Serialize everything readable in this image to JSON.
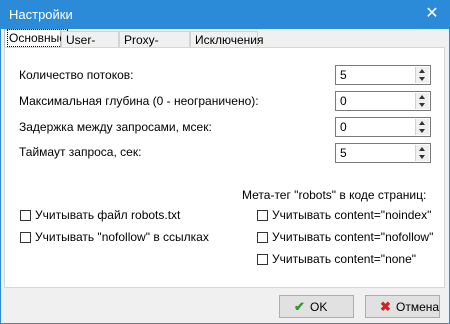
{
  "window": {
    "title": "Настройки",
    "close_glyph": "✕"
  },
  "tabs": [
    {
      "label": "Основные",
      "active": true
    },
    {
      "label": "User-Agent",
      "active": false
    },
    {
      "label": "Proxy-сервер",
      "active": false
    },
    {
      "label": "Исключения",
      "active": false
    }
  ],
  "fields": [
    {
      "label": "Количество потоков:",
      "value": "5"
    },
    {
      "label": "Максимальная глубина (0 - неограничено):",
      "value": "0"
    },
    {
      "label": "Задержка между запросами, мсек:",
      "value": "0"
    },
    {
      "label": "Таймаут запроса, сек:",
      "value": "5"
    }
  ],
  "left_checks": [
    {
      "label": "Учитывать файл robots.txt",
      "checked": false
    },
    {
      "label": "Учитывать \"nofollow\" в ссылках",
      "checked": false
    }
  ],
  "meta": {
    "title": "Мета-тег \"robots\" в коде страниц:",
    "checks": [
      {
        "label": "Учитывать content=\"noindex\"",
        "checked": false
      },
      {
        "label": "Учитывать content=\"nofollow\"",
        "checked": false
      },
      {
        "label": "Учитывать content=\"none\"",
        "checked": false
      }
    ]
  },
  "buttons": {
    "ok": {
      "label": "OK",
      "icon": "check-icon",
      "color": "#2e9b2e"
    },
    "cancel": {
      "label": "Отмена",
      "icon": "x-icon",
      "color": "#d32222"
    }
  },
  "colors": {
    "titlebar": "#2b8bd9"
  }
}
